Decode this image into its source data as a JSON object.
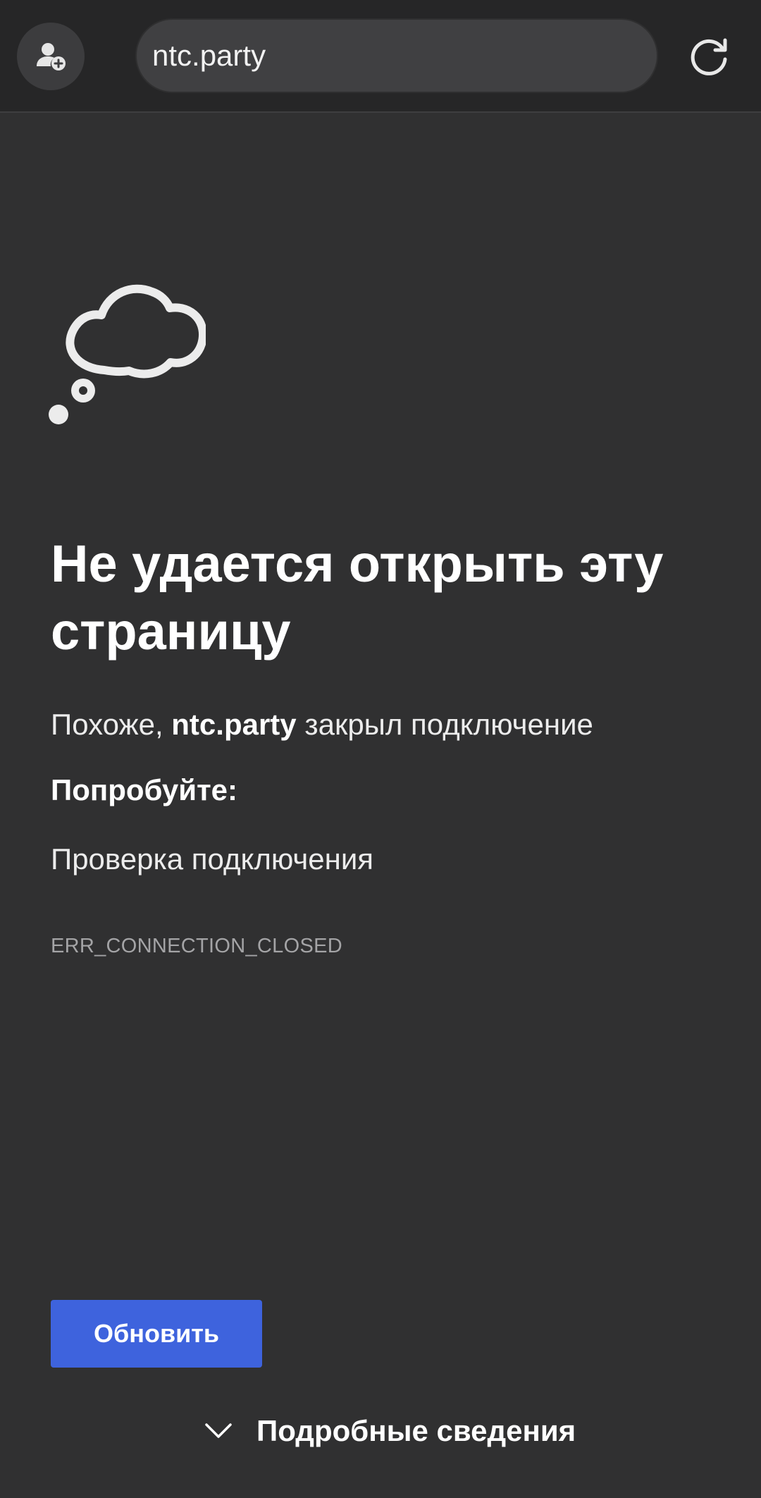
{
  "toolbar": {
    "url": "ntc.party",
    "profile_icon": "profile-add-icon",
    "reload_icon": "reload-icon"
  },
  "error": {
    "icon": "thought-cloud-icon",
    "title": "Не удается открыть эту страницу",
    "summary_prefix": "Похоже, ",
    "summary_host": "ntc.party",
    "summary_suffix": " закрыл подключение",
    "try_label": "Попробуйте:",
    "suggestion": "Проверка подключения",
    "code": "ERR_CONNECTION_CLOSED"
  },
  "actions": {
    "reload_label": "Обновить",
    "details_label": "Подробные сведения",
    "details_icon": "chevron-down-icon"
  },
  "colors": {
    "background": "#303031",
    "toolbar": "#262627",
    "accent": "#3e63dd"
  }
}
